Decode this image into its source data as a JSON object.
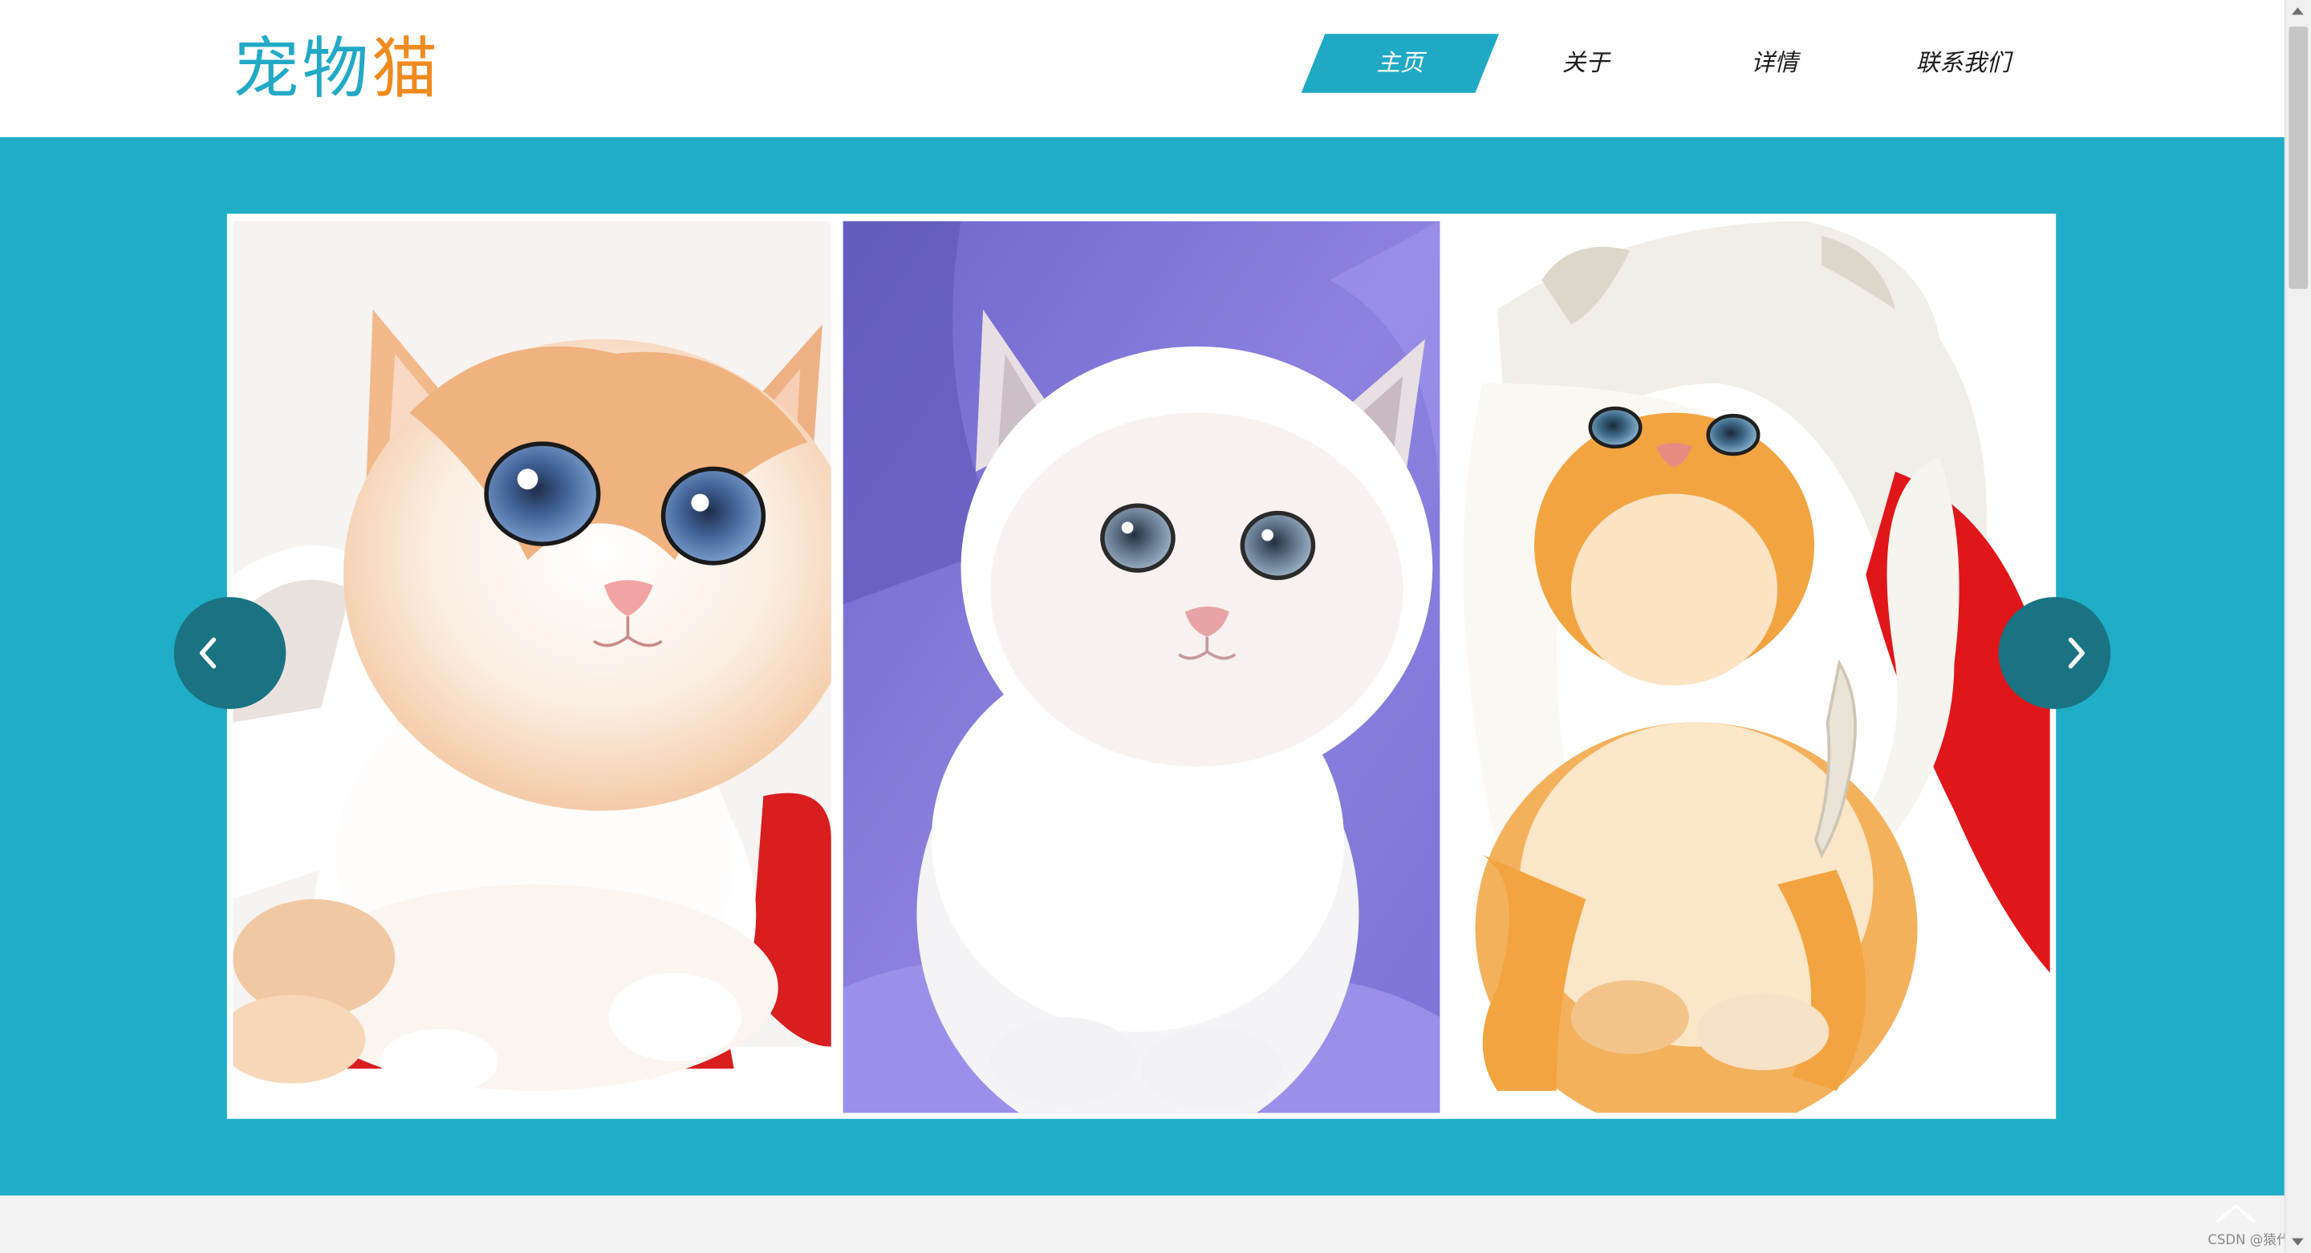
{
  "logo": {
    "part1": "宠物",
    "part2": "猫"
  },
  "nav": {
    "items": [
      {
        "label": "主页",
        "active": true
      },
      {
        "label": "关于",
        "active": false
      },
      {
        "label": "详情",
        "active": false
      },
      {
        "label": "联系我们",
        "active": false
      }
    ]
  },
  "carousel": {
    "slides": [
      {
        "subject": "orange-white kitten with blue eyes on red-white blanket"
      },
      {
        "subject": "white fluffy kitten on purple background"
      },
      {
        "subject": "orange tabby kitten under white and red hat"
      }
    ],
    "prev_icon": "chevron-left-icon",
    "next_icon": "chevron-right-icon"
  },
  "footer": {
    "watermark": "CSDN @猿代码"
  },
  "colors": {
    "accent": "#1fadc7",
    "logo_blue": "#22a9c6",
    "logo_orange": "#f08a1f",
    "arrow_bg": "#197382",
    "page_bg": "#f3f3f3"
  }
}
